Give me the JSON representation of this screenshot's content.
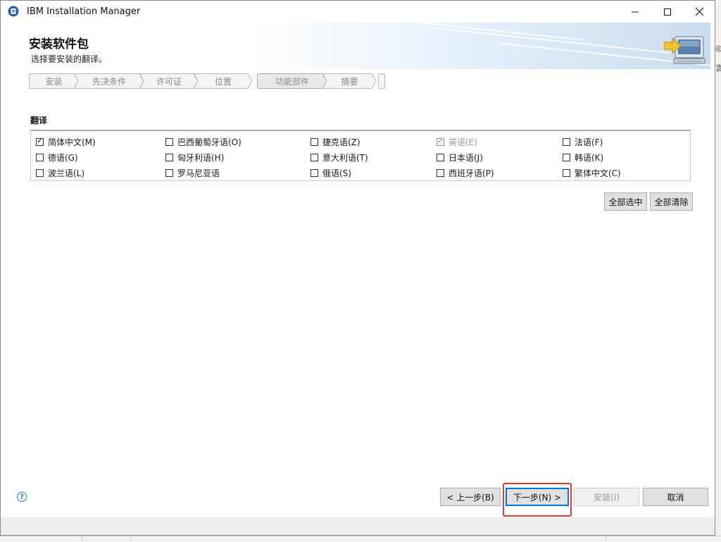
{
  "window": {
    "title": "IBM Installation Manager"
  },
  "banner": {
    "title": "安装软件包",
    "subtitle": "选择要安装的翻译。"
  },
  "steps": [
    "安装",
    "先决条件",
    "许可证",
    "位置",
    "功能部件",
    "摘要"
  ],
  "translations": {
    "section_title": "翻译",
    "languages": [
      {
        "label": "简体中文(M)",
        "checked": true,
        "disabled": false
      },
      {
        "label": "巴西葡萄牙语(O)",
        "checked": false,
        "disabled": false
      },
      {
        "label": "捷克语(Z)",
        "checked": false,
        "disabled": false
      },
      {
        "label": "英语(E)",
        "checked": true,
        "disabled": true
      },
      {
        "label": "法语(F)",
        "checked": false,
        "disabled": false
      },
      {
        "label": "德语(G)",
        "checked": false,
        "disabled": false
      },
      {
        "label": "匈牙利语(H)",
        "checked": false,
        "disabled": false
      },
      {
        "label": "意大利语(T)",
        "checked": false,
        "disabled": false
      },
      {
        "label": "日本语(J)",
        "checked": false,
        "disabled": false
      },
      {
        "label": "韩语(K)",
        "checked": false,
        "disabled": false
      },
      {
        "label": "波兰语(L)",
        "checked": false,
        "disabled": false
      },
      {
        "label": "罗马尼亚语",
        "checked": false,
        "disabled": false
      },
      {
        "label": "俄语(S)",
        "checked": false,
        "disabled": false
      },
      {
        "label": "西班牙语(P)",
        "checked": false,
        "disabled": false
      },
      {
        "label": "繁体中文(C)",
        "checked": false,
        "disabled": false
      }
    ],
    "select_all_label": "全部选中",
    "clear_all_label": "全部清除"
  },
  "footer": {
    "help_glyph": "?",
    "back_label": "< 上一步(B)",
    "next_label": "下一步(N) >",
    "install_label": "安装(I)",
    "cancel_label": "取消"
  },
  "colors": {
    "highlight": "#e53935",
    "focus": "#0078d7"
  }
}
